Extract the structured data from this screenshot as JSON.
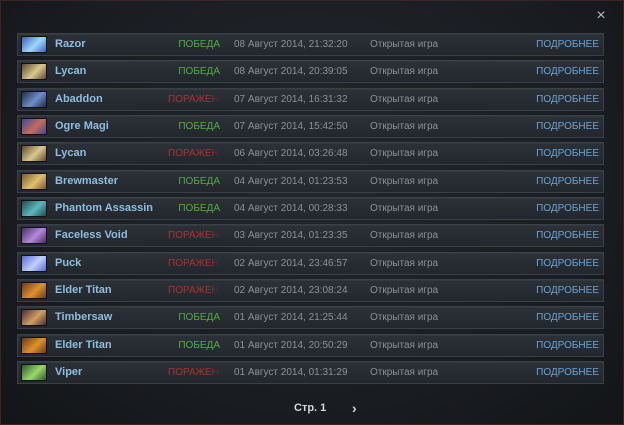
{
  "close_icon": "×",
  "matches": [
    {
      "hero": "Razor",
      "result": "ПОБЕДА",
      "outcome": "win",
      "date": "08 Август 2014, 21:32:20",
      "mode": "Открытая игра",
      "details": "ПОДРОБНЕЕ",
      "icon_colors": [
        "#3a5fbf",
        "#9fd8ff"
      ]
    },
    {
      "hero": "Lycan",
      "result": "ПОБЕДА",
      "outcome": "win",
      "date": "08 Август 2014, 20:39:05",
      "mode": "Открытая игра",
      "details": "ПОДРОБНЕЕ",
      "icon_colors": [
        "#5a4a2a",
        "#d8c890"
      ]
    },
    {
      "hero": "Abaddon",
      "result": "ПОРАЖЕНИЕ",
      "outcome": "loss",
      "date": "07 Август 2014, 16:31:32",
      "mode": "Открытая игра",
      "details": "ПОДРОБНЕЕ",
      "icon_colors": [
        "#1d2a4a",
        "#6f8fc8"
      ]
    },
    {
      "hero": "Ogre Magi",
      "result": "ПОБЕДА",
      "outcome": "win",
      "date": "07 Август 2014, 15:42:50",
      "mode": "Открытая игра",
      "details": "ПОДРОБНЕЕ",
      "icon_colors": [
        "#3b4a9a",
        "#c86a5a"
      ]
    },
    {
      "hero": "Lycan",
      "result": "ПОРАЖЕНИЕ",
      "outcome": "loss",
      "date": "06 Август 2014, 03:26:48",
      "mode": "Открытая игра",
      "details": "ПОДРОБНЕЕ",
      "icon_colors": [
        "#5a4a2a",
        "#d8c890"
      ]
    },
    {
      "hero": "Brewmaster",
      "result": "ПОБЕДА",
      "outcome": "win",
      "date": "04 Август 2014, 01:23:53",
      "mode": "Открытая игра",
      "details": "ПОДРОБНЕЕ",
      "icon_colors": [
        "#7a5a2a",
        "#e0c070"
      ]
    },
    {
      "hero": "Phantom Assassin",
      "result": "ПОБЕДА",
      "outcome": "win",
      "date": "04 Август 2014, 00:28:33",
      "mode": "Открытая игра",
      "details": "ПОДРОБНЕЕ",
      "icon_colors": [
        "#1f4a4a",
        "#5ab8c0"
      ]
    },
    {
      "hero": "Faceless Void",
      "result": "ПОРАЖЕНИЕ",
      "outcome": "loss",
      "date": "03 Август 2014, 01:23:35",
      "mode": "Открытая игра",
      "details": "ПОДРОБНЕЕ",
      "icon_colors": [
        "#4a2a6a",
        "#b08ad8"
      ]
    },
    {
      "hero": "Puck",
      "result": "ПОРАЖЕНИЕ",
      "outcome": "loss",
      "date": "02 Август 2014, 23:46:57",
      "mode": "Открытая игра",
      "details": "ПОДРОБНЕЕ",
      "icon_colors": [
        "#5a6ad0",
        "#c0d0ff"
      ]
    },
    {
      "hero": "Elder Titan",
      "result": "ПОРАЖЕНИЕ",
      "outcome": "loss",
      "date": "02 Август 2014, 23:08:24",
      "mode": "Открытая игра",
      "details": "ПОДРОБНЕЕ",
      "icon_colors": [
        "#6a3a1a",
        "#e09030"
      ]
    },
    {
      "hero": "Timbersaw",
      "result": "ПОБЕДА",
      "outcome": "win",
      "date": "01 Август 2014, 21:25:44",
      "mode": "Открытая игра",
      "details": "ПОДРОБНЕЕ",
      "icon_colors": [
        "#4a2a3a",
        "#d0a060"
      ]
    },
    {
      "hero": "Elder Titan",
      "result": "ПОБЕДА",
      "outcome": "win",
      "date": "01 Август 2014, 20:50:29",
      "mode": "Открытая игра",
      "details": "ПОДРОБНЕЕ",
      "icon_colors": [
        "#6a3a1a",
        "#e09030"
      ]
    },
    {
      "hero": "Viper",
      "result": "ПОРАЖЕНИЕ",
      "outcome": "loss",
      "date": "01 Август 2014, 01:31:29",
      "mode": "Открытая игра",
      "details": "ПОДРОБНЕЕ",
      "icon_colors": [
        "#2a5a2a",
        "#9ad86a"
      ]
    }
  ],
  "pager": {
    "label": "Стр. 1",
    "next_icon": "›"
  }
}
